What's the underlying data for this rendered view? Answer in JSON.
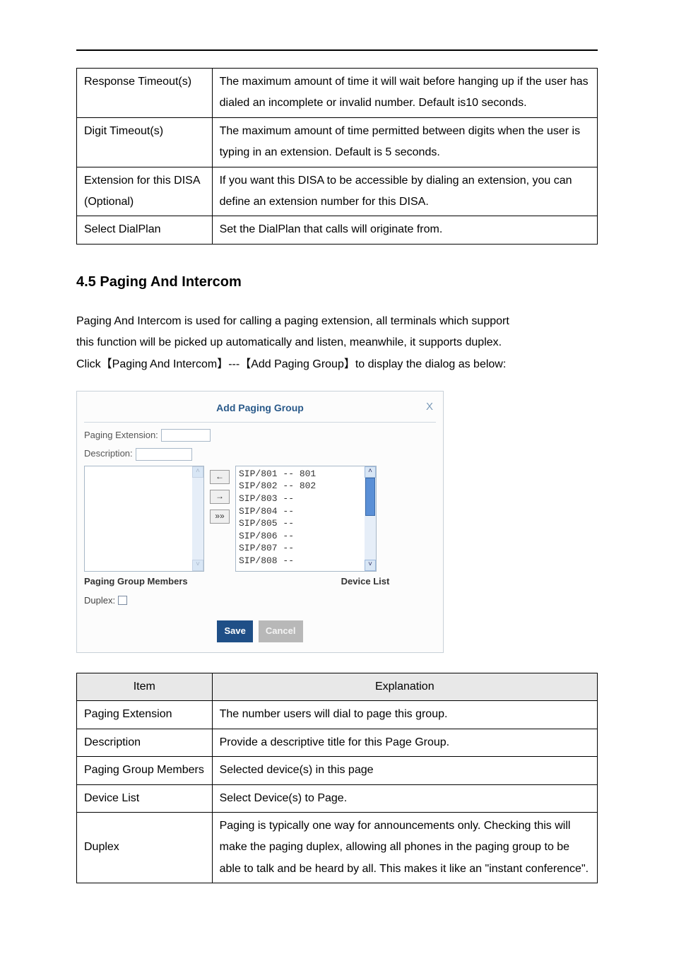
{
  "table1": {
    "rows": [
      {
        "item": "Response Timeout(s)",
        "exp": "The maximum amount of time it will wait before hanging up if the user has dialed an incomplete or invalid number. Default is10 seconds."
      },
      {
        "item": "Digit Timeout(s)",
        "exp": "The maximum amount of time permitted between digits when the user is typing in an extension. Default is 5 seconds."
      },
      {
        "item": "Extension for this DISA (Optional)",
        "exp": "If you want this DISA to be accessible by dialing an extension, you can define an extension number for this DISA."
      },
      {
        "item": "Select DialPlan",
        "exp": "Set the DialPlan that calls will originate from."
      }
    ]
  },
  "section": {
    "heading": "4.5 Paging And Intercom",
    "para_line1": "Paging And Intercom is used for calling a paging extension, all terminals which support",
    "para_line2": "this function will be picked up automatically and listen, meanwhile, it supports duplex.",
    "para_line3": "Click【Paging And Intercom】---【Add Paging Group】to display the dialog as below:"
  },
  "dialog": {
    "title": "Add Paging Group",
    "close": "X",
    "paging_ext_label": "Paging Extension:",
    "description_label": "Description:",
    "move_left": "←",
    "move_right": "→",
    "move_all": "»»",
    "device_items": [
      "SIP/801 -- 801",
      "SIP/802 -- 802",
      "SIP/803 --",
      "SIP/804 --",
      "SIP/805 --",
      "SIP/806 --",
      "SIP/807 --",
      "SIP/808 --"
    ],
    "members_label": "Paging Group Members",
    "devicelist_label": "Device List",
    "duplex_label": "Duplex:",
    "save": "Save",
    "cancel": "Cancel"
  },
  "table2": {
    "header_item": "Item",
    "header_exp": "Explanation",
    "rows": [
      {
        "item": "Paging Extension",
        "exp": "The number users will dial to page this group."
      },
      {
        "item": "Description",
        "exp": "Provide a descriptive title for this Page Group."
      },
      {
        "item": "Paging Group Members",
        "exp": "Selected device(s) in this page"
      },
      {
        "item": "Device List",
        "exp": "Select Device(s) to Page."
      },
      {
        "item": "Duplex",
        "exp": "Paging is typically one way for announcements only. Checking this will make the paging duplex, allowing all phones in the paging group to be able to talk and be heard by all. This makes it like an \"instant conference\"."
      }
    ]
  }
}
